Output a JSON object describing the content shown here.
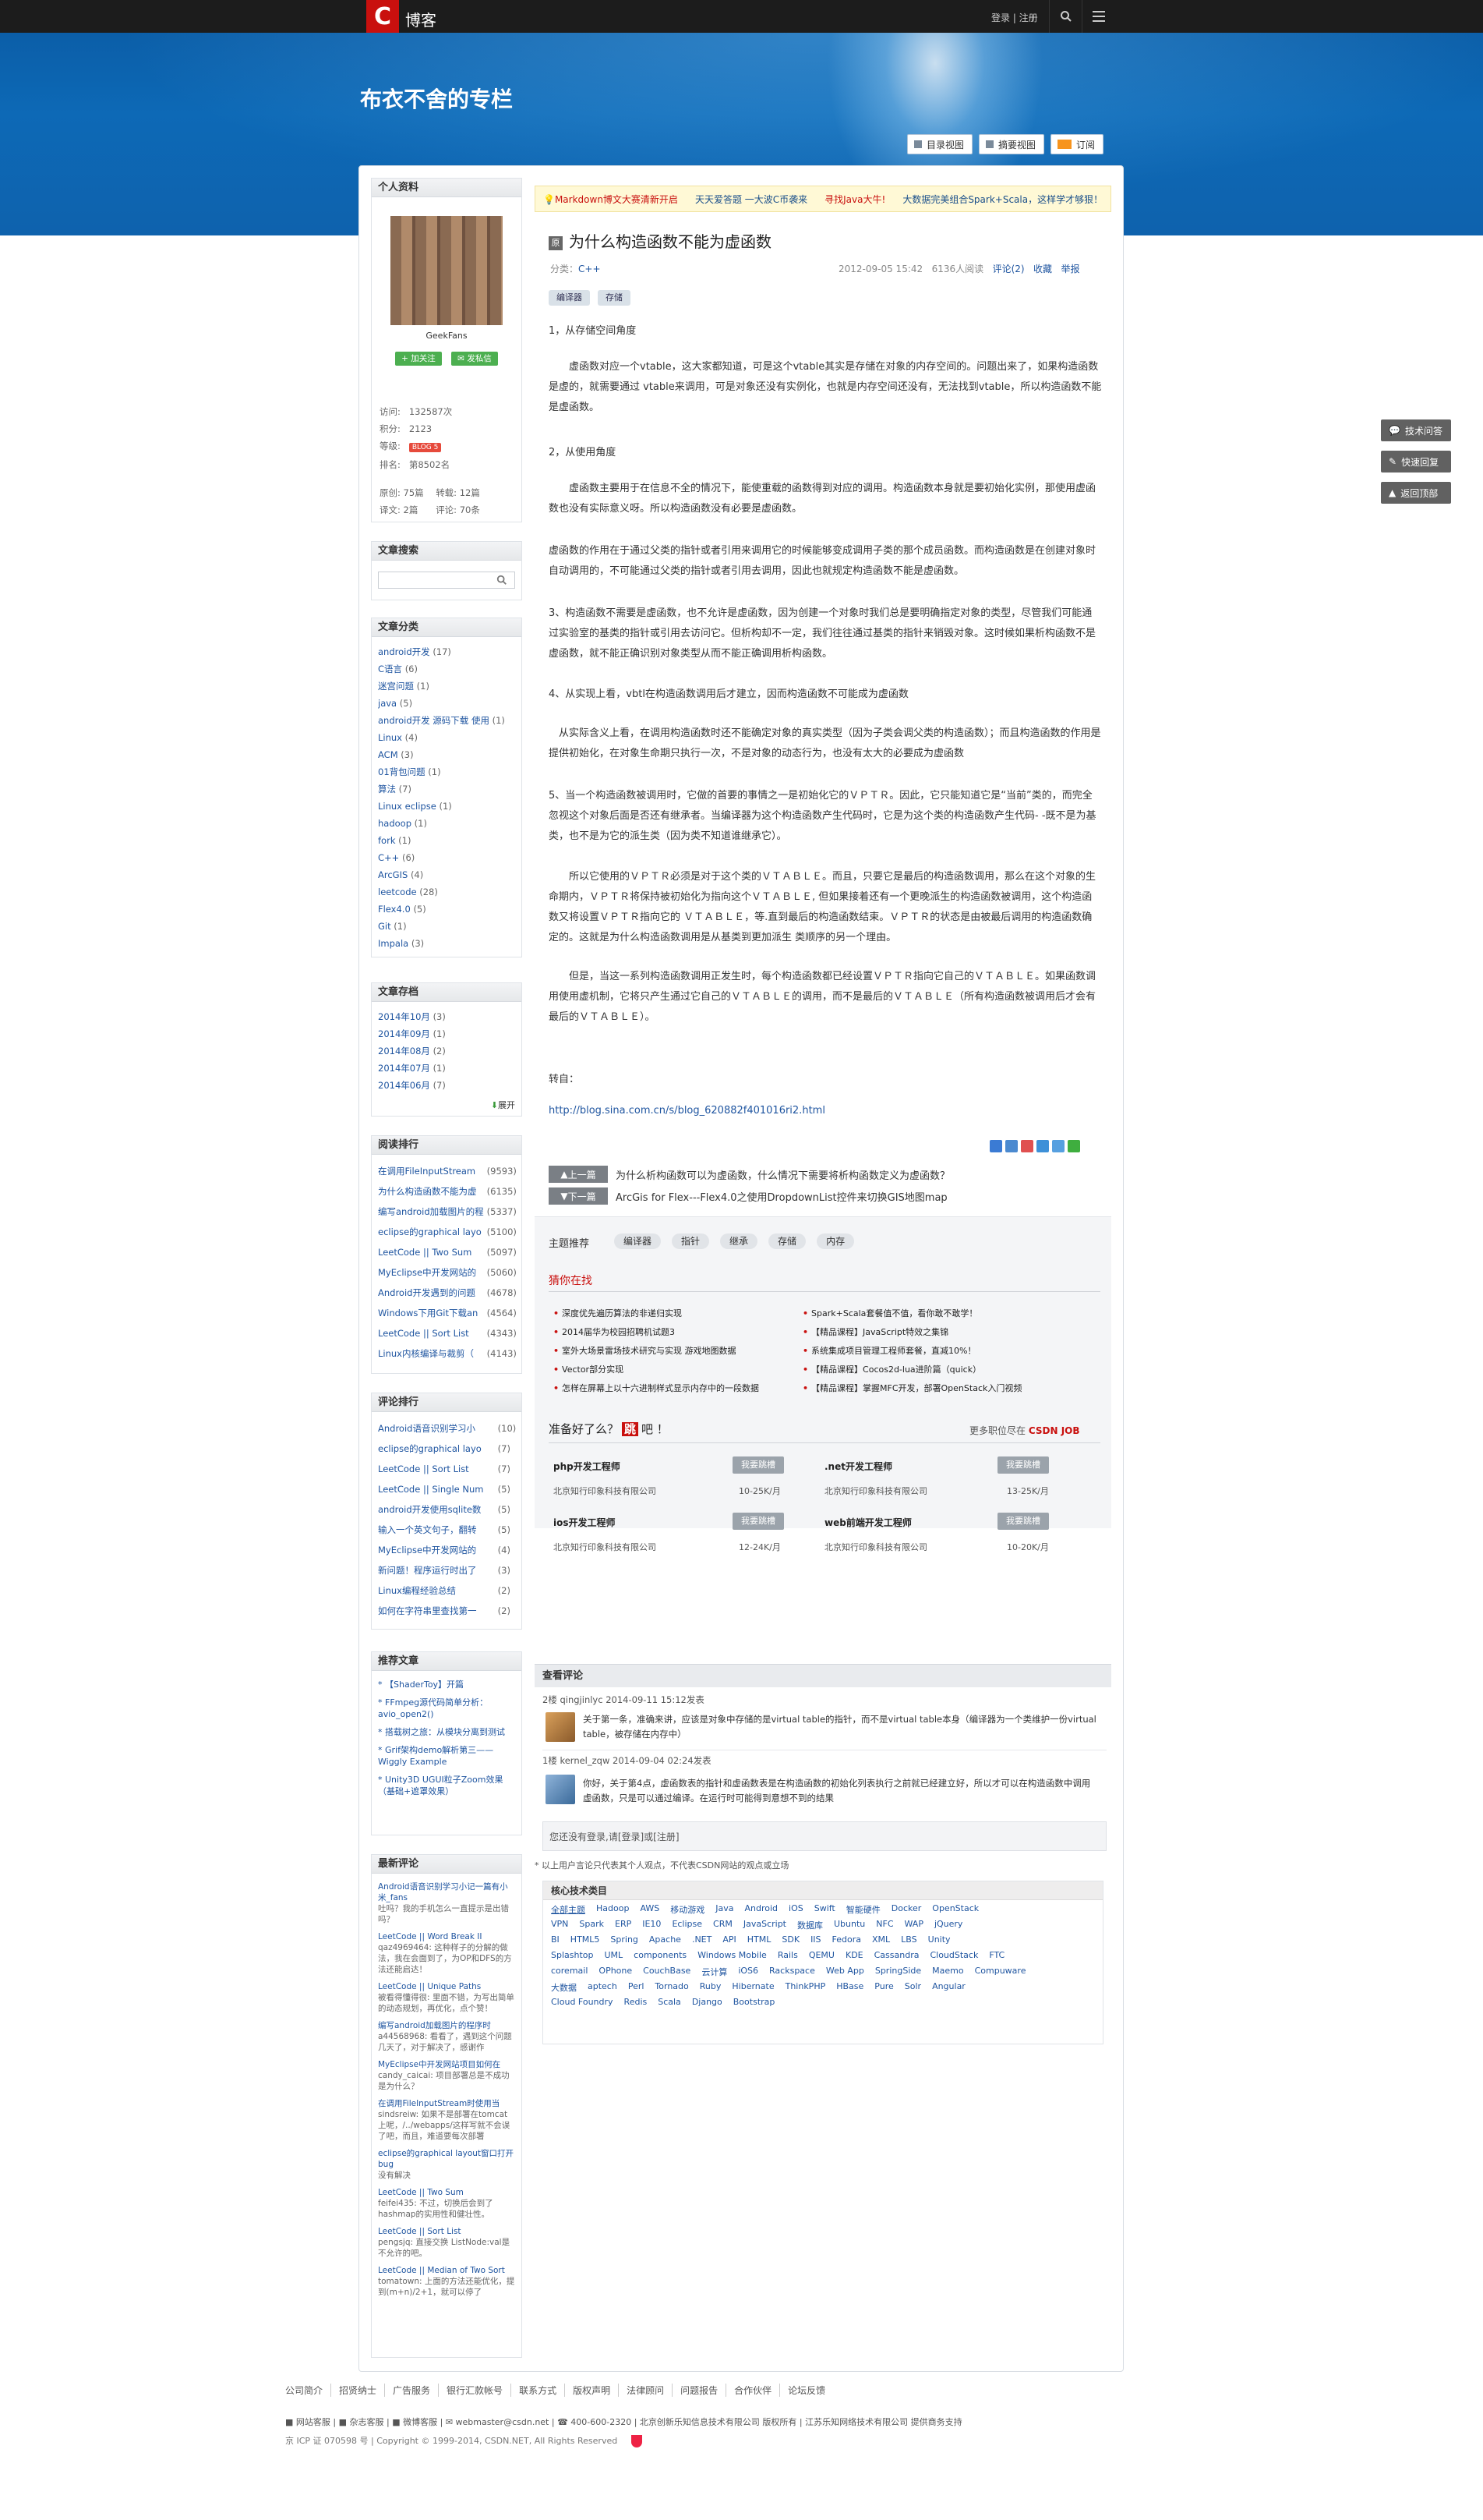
{
  "brand": {
    "logo_letter": "C",
    "name": "博客",
    "login_links": "登录 | 注册",
    "blog_title": "布衣不舍的专栏"
  },
  "views": {
    "toc": "目录视图",
    "summary": "摘要视图",
    "rss": "订阅"
  },
  "profile": {
    "heading": "个人资料",
    "username": "GeekFans",
    "follow": "+ 加关注",
    "message": "发私信",
    "visits_label": "访问:",
    "visits": "132587次",
    "points_label": "积分:",
    "points": "2123",
    "level_label": "等级:",
    "level": "BLOG 5",
    "rank_label": "排名:",
    "rank": "第8502名",
    "original_label": "原创:",
    "original": "75篇",
    "repost_label": "转载:",
    "repost": "12篇",
    "translated_label": "译文:",
    "translated": "2篇",
    "comments_label": "评论:",
    "comments": "70条"
  },
  "search_panel": {
    "heading": "文章搜索"
  },
  "categories": {
    "heading": "文章分类",
    "items": [
      {
        "name": "android开发",
        "count": "(17)"
      },
      {
        "name": "C语言",
        "count": "(6)"
      },
      {
        "name": "迷宫问题",
        "count": "(1)"
      },
      {
        "name": "java",
        "count": "(5)"
      },
      {
        "name": "android开发 源码下载 使用",
        "count": "(1)"
      },
      {
        "name": "Linux",
        "count": "(4)"
      },
      {
        "name": "ACM",
        "count": "(3)"
      },
      {
        "name": "01背包问题",
        "count": "(1)"
      },
      {
        "name": "算法",
        "count": "(7)"
      },
      {
        "name": "Linux eclipse",
        "count": "(1)"
      },
      {
        "name": "hadoop",
        "count": "(1)"
      },
      {
        "name": "fork",
        "count": "(1)"
      },
      {
        "name": "C++",
        "count": "(6)"
      },
      {
        "name": "ArcGIS",
        "count": "(4)"
      },
      {
        "name": "leetcode",
        "count": "(28)"
      },
      {
        "name": "Flex4.0",
        "count": "(5)"
      },
      {
        "name": "Git",
        "count": "(1)"
      },
      {
        "name": "Impala",
        "count": "(3)"
      }
    ]
  },
  "archive": {
    "heading": "文章存档",
    "items": [
      {
        "name": "2014年10月",
        "count": "(3)"
      },
      {
        "name": "2014年09月",
        "count": "(1)"
      },
      {
        "name": "2014年08月",
        "count": "(2)"
      },
      {
        "name": "2014年07月",
        "count": "(1)"
      },
      {
        "name": "2014年06月",
        "count": "(7)"
      }
    ],
    "expand": "展开"
  },
  "top_read": {
    "heading": "阅读排行",
    "items": [
      {
        "name": "在调用FileInputStream",
        "count": "(9593)"
      },
      {
        "name": "为什么构造函数不能为虚",
        "count": "(6135)"
      },
      {
        "name": "编写android加载图片的程",
        "count": "(5337)"
      },
      {
        "name": "eclipse的graphical layo",
        "count": "(5100)"
      },
      {
        "name": "LeetCode || Two Sum",
        "count": "(5097)"
      },
      {
        "name": "MyEclipse中开发网站的",
        "count": "(5060)"
      },
      {
        "name": "Android开发遇到的问题",
        "count": "(4678)"
      },
      {
        "name": "Windows下用Git下载an",
        "count": "(4564)"
      },
      {
        "name": "LeetCode || Sort List",
        "count": "(4343)"
      },
      {
        "name": "Linux内核编译与裁剪（",
        "count": "(4143)"
      }
    ]
  },
  "top_comment": {
    "heading": "评论排行",
    "items": [
      {
        "name": "Android语音识别学习小",
        "count": "(10)"
      },
      {
        "name": "eclipse的graphical layo",
        "count": "(7)"
      },
      {
        "name": "LeetCode || Sort List",
        "count": "(7)"
      },
      {
        "name": "LeetCode || Single Num",
        "count": "(5)"
      },
      {
        "name": "android开发使用sqlite数",
        "count": "(5)"
      },
      {
        "name": "输入一个英文句子，翻转",
        "count": "(5)"
      },
      {
        "name": "MyEclipse中开发网站的",
        "count": "(4)"
      },
      {
        "name": "新问题！程序运行时出了",
        "count": "(3)"
      },
      {
        "name": "Linux编程经验总结",
        "count": "(2)"
      },
      {
        "name": "如何在字符串里查找第一",
        "count": "(2)"
      }
    ]
  },
  "recommended": {
    "heading": "推荐文章",
    "items": [
      "【ShaderToy】开篇",
      "FFmpeg源代码简单分析：avio_open2()",
      "搭载树之旅：从模块分离到测试",
      "Grif架构demo解析第三——Wiggly Example",
      "Unity3D UGUI粒子Zoom效果（基础+遮罩效果）"
    ]
  },
  "recent_comments": {
    "heading": "最新评论",
    "items": [
      {
        "title": "Android语音识别学习小记一篇有小米_fans",
        "body": "吐吗？我的手机怎么一直提示是出错吗？"
      },
      {
        "title": "LeetCode || Word Break II",
        "body": "qaz4969464: 这种样子的分解的做法，我在会面到了，为OP和DFS的方法还能启达！"
      },
      {
        "title": "LeetCode || Unique Paths",
        "body": "被看得懂得很: 里面不错，为写出简单的动态规划，再优化，点个赞！"
      },
      {
        "title": "编写android加载图片的程序时",
        "body": "a44568968: 看看了，遇到这个问题几天了，对于解决了，感谢作"
      },
      {
        "title": "MyEclipse中开发网站项目如何在",
        "body": "candy_caicai: 项目部署总是不成功是为什么？"
      },
      {
        "title": "在调用FileInputStream时使用当",
        "body": "sindsreiw: 如果不是部署在tomcat上呢，/../webapps/这样写就不会误了吧，而且，难道要每次部署"
      },
      {
        "title": "eclipse的graphical layout窗口打开bug",
        "body": "没有解决"
      },
      {
        "title": "LeetCode || Two Sum",
        "body": "feifei435: 不过，切换后会到了hashmap的实用性和健壮性。"
      },
      {
        "title": "LeetCode || Sort List",
        "body": "pengsjq: 直接交换 ListNode:val是不允许的吧。"
      },
      {
        "title": "LeetCode || Median of Two Sort",
        "body": "tomatown: 上面的方法还能优化，提到(m+n)/2+1，就可以停了"
      }
    ]
  },
  "ad_bar": [
    "Markdown博文大赛清新开启",
    "天天爱答题 一大波C币袭来",
    "寻找Java大牛!",
    "大数据完美组合Spark+Scala，这样学才够狠！"
  ],
  "article": {
    "title": "为什么构造函数不能为虚函数",
    "title_icon": "原",
    "category_label": "分类：",
    "category": "C++",
    "date": "2012-09-05 15:42",
    "reads": "6136人阅读",
    "comments": "评论(2)",
    "favorite": "收藏",
    "report": "举报",
    "tags": [
      "编译器",
      "存储"
    ],
    "paragraphs": [
      "1，从存储空间角度",
      "　　虚函数对应一个vtable，这大家都知道，可是这个vtable其实是存储在对象的内存空间的。问题出来了，如果构造函数是虚的，就需要通过 vtable来调用，可是对象还没有实例化，也就是内存空间还没有，无法找到vtable，所以构造函数不能是虚函数。",
      "2，从使用角度",
      "　　虚函数主要用于在信息不全的情况下，能使重载的函数得到对应的调用。构造函数本身就是要初始化实例，那使用虚函数也没有实际意义呀。所以构造函数没有必要是虚函数。",
      "虚函数的作用在于通过父类的指针或者引用来调用它的时候能够变成调用子类的那个成员函数。而构造函数是在创建对象时自动调用的，不可能通过父类的指针或者引用去调用，因此也就规定构造函数不能是虚函数。",
      "3、构造函数不需要是虚函数，也不允许是虚函数，因为创建一个对象时我们总是要明确指定对象的类型，尽管我们可能通过实验室的基类的指针或引用去访问它。但析构却不一定，我们往往通过基类的指针来销毁对象。这时候如果析构函数不是虚函数，就不能正确识别对象类型从而不能正确调用析构函数。",
      "4、从实现上看，vbtl在构造函数调用后才建立，因而构造函数不可能成为虚函数",
      "　从实际含义上看，在调用构造函数时还不能确定对象的真实类型（因为子类会调父类的构造函数）；而且构造函数的作用是提供初始化，在对象生命期只执行一次，不是对象的动态行为，也没有太大的必要成为虚函数",
      "5、当一个构造函数被调用时，它做的首要的事情之一是初始化它的ＶＰＴＲ。因此，它只能知道它是“当前”类的，而完全忽视这个对象后面是否还有继承者。当编译器为这个构造函数产生代码时，它是为这个类的构造函数产生代码- -既不是为基类，也不是为它的派生类（因为类不知道谁继承它）。",
      "　　所以它使用的ＶＰＴＲ必须是对于这个类的ＶＴＡＢＬＥ。而且，只要它是最后的构造函数调用，那么在这个对象的生命期内，ＶＰＴＲ将保持被初始化为指向这个ＶＴＡＢＬＥ, 但如果接着还有一个更晚派生的构造函数被调用，这个构造函数又将设置ＶＰＴＲ指向它的 ＶＴＡＢＬＥ，等.直到最后的构造函数结束。ＶＰＴＲ的状态是由被最后调用的构造函数确定的。这就是为什么构造函数调用是从基类到更加派生 类顺序的另一个理由。",
      "　　但是，当这一系列构造函数调用正发生时，每个构造函数都已经设置ＶＰＴＲ指向它自己的ＶＴＡＢＬＥ。如果函数调用使用虚机制，它将只产生通过它自己的ＶＴＡＢＬＥ的调用，而不是最后的ＶＴＡＢＬＥ（所有构造函数被调用后才会有最后的ＶＴＡＢＬＥ）。",
      "转自：",
      "http://blog.sina.com.cn/s/blog_620882f401016ri2.html"
    ]
  },
  "nav": {
    "prev_label": "上一篇",
    "prev": "为什么析构函数可以为虚函数，什么情况下需要将析构函数定义为虚函数？",
    "next_label": "下一篇",
    "next": "ArcGis for Flex---Flex4.0之使用DropdownList控件来切换GIS地图map"
  },
  "topics": {
    "label": "主题推荐",
    "chips": [
      "编译器",
      "指针",
      "继承",
      "存储",
      "内存"
    ]
  },
  "guess": {
    "heading": "猜你在找",
    "left": [
      "深度优先遍历算法的非递归实现",
      "2014届华为校园招聘机试题3",
      "室外大场景雷场技术研究与实现 游戏地图数据",
      "Vector部分实现",
      "怎样在屏幕上以十六进制样式显示内存中的一段数据"
    ],
    "right": [
      "Spark+Scala套餐值不值，看你敢不敢学！",
      "【精品课程】JavaScript特效之集锦",
      "系统集成项目管理工程师套餐，直减10%！",
      "【精品课程】Cocos2d-lua进阶篇（quick）",
      "【精品课程】掌握MFC开发，部署OpenStack入门视频"
    ]
  },
  "jobs": {
    "heading": "准备好了么？",
    "heading_jump": "跳",
    "heading_tail": "吧 ！",
    "more": "更多职位尽在",
    "more_brand": "CSDN JOB",
    "apply": "我要跳槽",
    "items": [
      {
        "title": "php开发工程师",
        "company": "北京知行印象科技有限公司",
        "salary": "10-25K/月"
      },
      {
        "title": ".net开发工程师",
        "company": "北京知行印象科技有限公司",
        "salary": "13-25K/月"
      },
      {
        "title": "ios开发工程师",
        "company": "北京知行印象科技有限公司",
        "salary": "12-24K/月"
      },
      {
        "title": "web前端开发工程师",
        "company": "北京知行印象科技有限公司",
        "salary": "10-20K/月"
      }
    ]
  },
  "comments": {
    "heading": "查看评论",
    "items": [
      {
        "meta": "2楼 qingjinlyc 2014-09-11 15:12发表",
        "body": "关于第一条，准确来讲，应该是对象中存储的是virtual table的指针，而不是virtual table本身（编译器为一个类维护一份virtual table，被存储在内存中）"
      },
      {
        "meta": "1楼 kernel_zqw 2014-09-04 02:24发表",
        "body": "你好，关于第4点，虚函数表的指针和虚函数表是在构造函数的初始化列表执行之前就已经建立好，所以才可以在构造函数中调用虚函数，只是可以通过编译。在运行时可能得到意想不到的结果"
      }
    ],
    "login_prompt": "您还没有登录,请[登录]或[注册]",
    "disclaimer": "* 以上用户言论只代表其个人观点，不代表CSDN网站的观点或立场"
  },
  "core_tech": {
    "heading": "核心技术类目",
    "keywords": [
      "全部主题",
      "Hadoop",
      "AWS",
      "移动游戏",
      "Java",
      "Android",
      "iOS",
      "Swift",
      "智能硬件",
      "Docker",
      "OpenStack",
      "VPN",
      "Spark",
      "ERP",
      "IE10",
      "Eclipse",
      "CRM",
      "JavaScript",
      "数据库",
      "Ubuntu",
      "NFC",
      "WAP",
      "jQuery",
      "BI",
      "HTML5",
      "Spring",
      "Apache",
      ".NET",
      "API",
      "HTML",
      "SDK",
      "IIS",
      "Fedora",
      "XML",
      "LBS",
      "Unity",
      "Splashtop",
      "UML",
      "components",
      "Windows Mobile",
      "Rails",
      "QEMU",
      "KDE",
      "Cassandra",
      "CloudStack",
      "FTC",
      "coremail",
      "OPhone",
      "CouchBase",
      "云计算",
      "iOS6",
      "Rackspace",
      "Web App",
      "SpringSide",
      "Maemo",
      "Compuware",
      "大数据",
      "aptech",
      "Perl",
      "Tornado",
      "Ruby",
      "Hibernate",
      "ThinkPHP",
      "HBase",
      "Pure",
      "Solr",
      "Angular",
      "Cloud Foundry",
      "Redis",
      "Scala",
      "Django",
      "Bootstrap"
    ]
  },
  "float_buttons": [
    "技术问答",
    "快速回复",
    "返回顶部"
  ],
  "footer": {
    "links": [
      "公司简介",
      "招贤纳士",
      "广告服务",
      "银行汇款帐号",
      "联系方式",
      "版权声明",
      "法律顾问",
      "问题报告",
      "合作伙伴",
      "论坛反馈"
    ],
    "contact": [
      "网站客服",
      "杂志客服",
      "微博客服",
      "webmaster@csdn.net",
      "400-600-2320",
      "北京创新乐知信息技术有限公司 版权所有",
      "江苏乐知网络技术有限公司 提供商务支持"
    ],
    "icp": "京 ICP 证 070598 号",
    "copyright": "Copyright © 1999-2014, CSDN.NET, All Rights Reserved"
  },
  "colors": {
    "brand_red": "#c9100e",
    "hero_blue": "#0d69b6",
    "link_blue": "#1a4f8a"
  }
}
